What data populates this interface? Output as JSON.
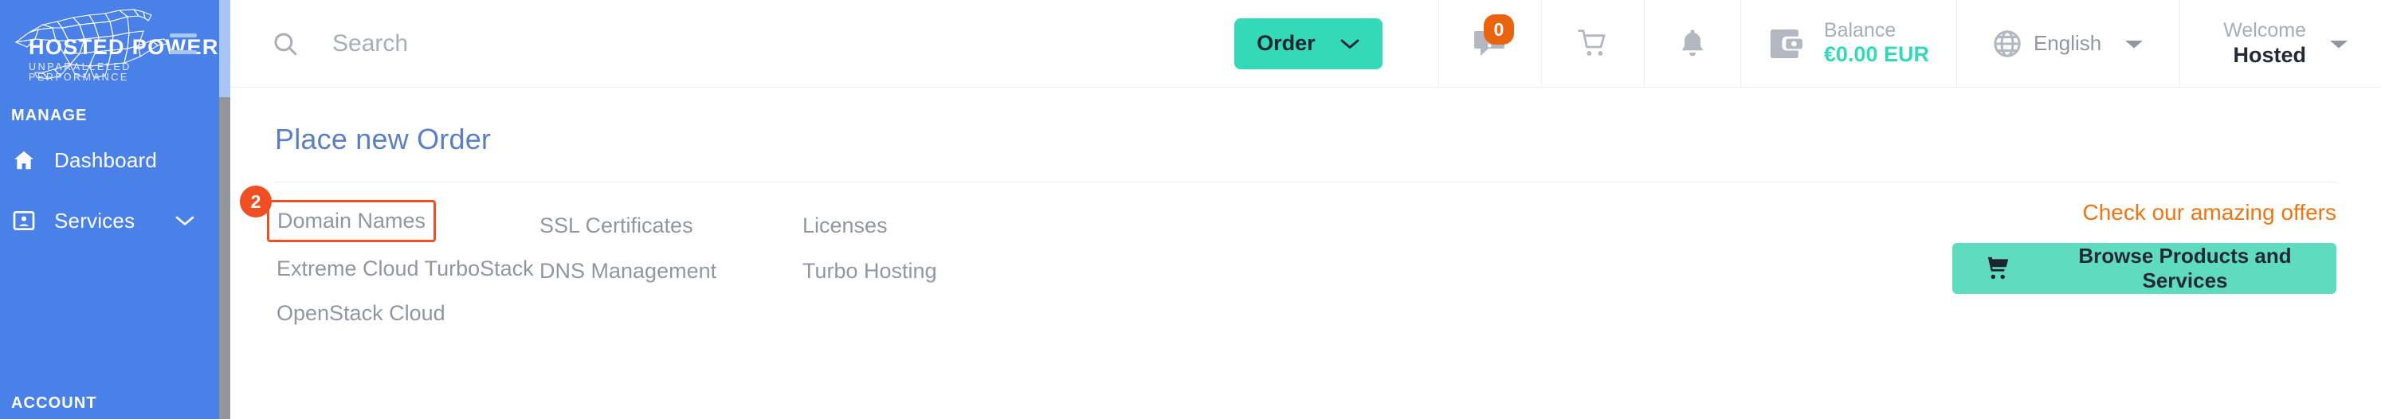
{
  "brand": {
    "name": "HOSTED POWER",
    "tagline": "UNPARALLELED PERFORMANCE",
    "logo_icon": "cheetah-wireframe-logo",
    "sidebar_color": "#4a81e8"
  },
  "topbar": {
    "search": {
      "placeholder": "Search",
      "value": "",
      "icon": "search-icon"
    },
    "order_button": {
      "label": "Order",
      "icon": "chevron-down-icon",
      "color": "#33d9b8"
    },
    "tickets": {
      "icon": "message-alert-icon",
      "badge": "0",
      "badge_color": "#e8640f"
    },
    "cart": {
      "icon": "shopping-cart-icon"
    },
    "notifications": {
      "icon": "bell-icon"
    },
    "balance": {
      "icon": "wallet-icon",
      "label": "Balance",
      "amount": "€0.00 EUR",
      "amount_color": "#33d9b8"
    },
    "language": {
      "icon": "globe-icon",
      "label": "English",
      "chevron": "caret-down-icon"
    },
    "user": {
      "welcome_label": "Welcome",
      "name": "Hosted",
      "chevron": "caret-down-icon"
    }
  },
  "sidebar": {
    "sections": [
      {
        "label": "MANAGE"
      },
      {
        "label": "ACCOUNT"
      }
    ],
    "items": [
      {
        "label": "Dashboard",
        "icon": "home-icon",
        "has_chevron": false
      },
      {
        "label": "Services",
        "icon": "contact-card-icon",
        "has_chevron": true,
        "chevron": "chevron-down-icon"
      }
    ]
  },
  "main": {
    "title": "Place new Order",
    "step_badge": "2",
    "columns": [
      {
        "links": [
          {
            "label": "Domain Names",
            "highlighted": true
          },
          {
            "label": "Extreme Cloud TurboStack",
            "highlighted": false
          },
          {
            "label": "OpenStack Cloud",
            "highlighted": false
          }
        ]
      },
      {
        "links": [
          {
            "label": "SSL Certificates",
            "highlighted": false
          },
          {
            "label": "DNS Management",
            "highlighted": false
          }
        ]
      },
      {
        "links": [
          {
            "label": "Licenses",
            "highlighted": false
          },
          {
            "label": "Turbo Hosting",
            "highlighted": false
          }
        ]
      }
    ],
    "offers": {
      "text": "Check our amazing offers",
      "text_color": "#f0740f",
      "button_label": "Browse Products and Services",
      "button_icon": "shopping-cart-icon",
      "button_color": "#5fdcc0"
    }
  }
}
